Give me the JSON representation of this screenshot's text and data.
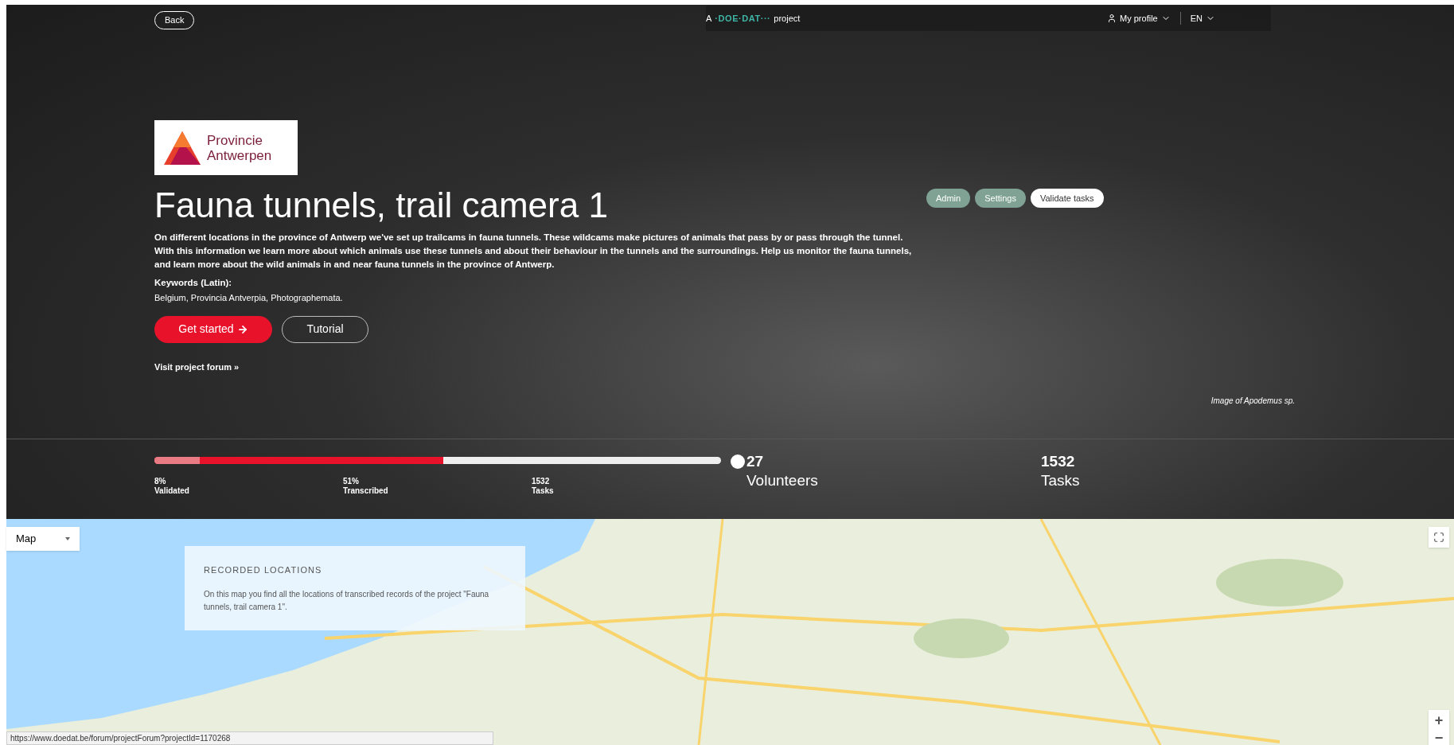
{
  "header": {
    "back": "Back",
    "brand_prefix": "A",
    "brand": "·DOE·DAT···",
    "brand_suffix": "project",
    "profile": "My profile",
    "language": "EN"
  },
  "project": {
    "logo_text": [
      "Provincie",
      "Antwerpen"
    ],
    "title": "Fauna tunnels, trail camera 1",
    "description": [
      "On different locations in the province of Antwerp we've set up trailcams in fauna tunnels. These wildcams make pictures of animals that pass by or pass through the tunnel.",
      "With this information we learn more about which animals use these tunnels and about their behaviour in the tunnels and the surroundings. Help us monitor the fauna tunnels, and learn more about the wild animals in and near fauna tunnels in the province of Antwerp."
    ],
    "keywords_label": "Keywords (Latin):",
    "keywords": "Belgium, Provincia Antverpia, Photographemata.",
    "get_started": "Get started",
    "tutorial": "Tutorial",
    "forum_link": "Visit project forum »",
    "admin_buttons": [
      {
        "label": "Admin",
        "kind": "filled"
      },
      {
        "label": "Settings",
        "kind": "filled"
      },
      {
        "label": "Validate tasks",
        "kind": "outline"
      }
    ],
    "image_caption": "Image of Apodemus sp."
  },
  "progress": {
    "segments": [
      {
        "kind": "transcribed",
        "level": 0.51
      },
      {
        "kind": "validated",
        "level": 0.08
      }
    ],
    "labels": [
      {
        "value": "8%",
        "label": "Validated"
      },
      {
        "value": "51%",
        "label": "Transcribed"
      },
      {
        "value": "1532",
        "label": "Tasks"
      }
    ],
    "stats": [
      {
        "value": "27",
        "label": "Volunteers"
      },
      {
        "value": "1532",
        "label": "Tasks"
      }
    ]
  },
  "map": {
    "type_select": "Map",
    "card_title": "RECORDED LOCATIONS",
    "card_text": "On this map you find all the locations of transcribed records of the project \"Fauna tunnels, trail camera 1\".",
    "zoom_in": "+",
    "zoom_out": "−"
  },
  "status_bar": "https://www.doedat.be/forum/projectForum?projectId=1170268"
}
